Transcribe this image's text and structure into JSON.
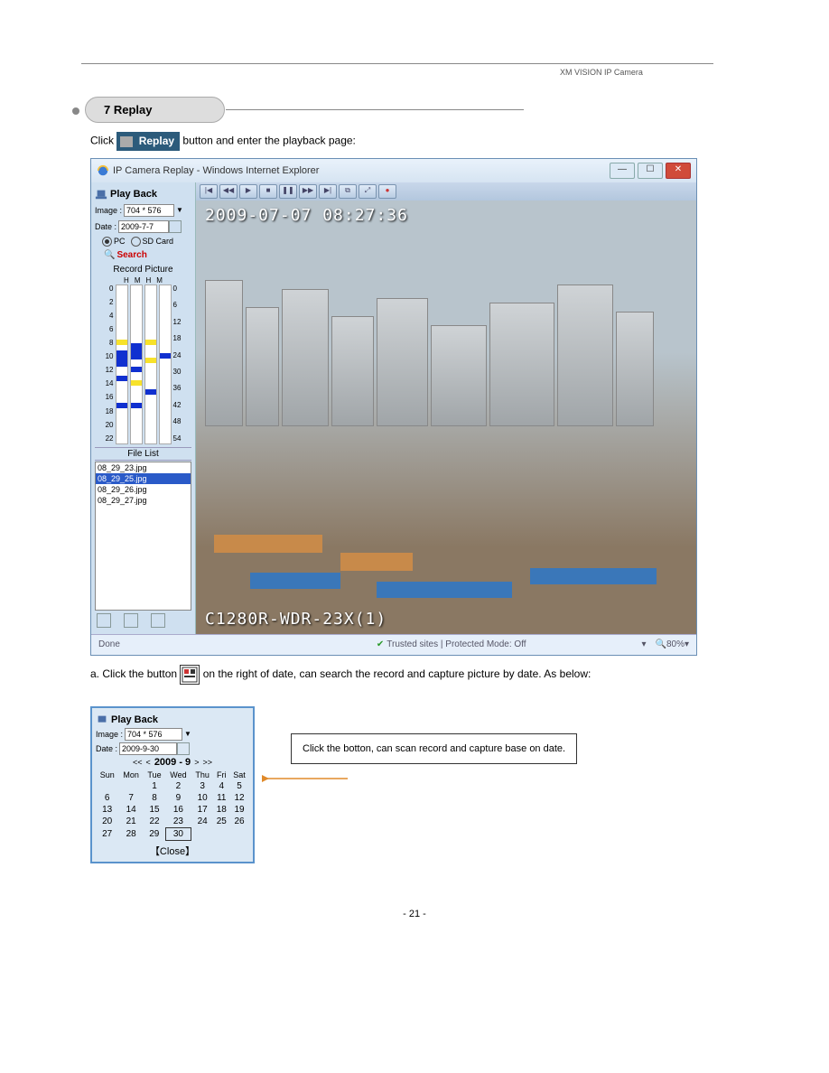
{
  "header": {
    "brand": "XM VISION  IP Camera"
  },
  "section": {
    "title": "7  Replay",
    "intro": "Click ",
    "intro_after": " button and enter the playback page:",
    "replay_label": "Replay"
  },
  "ie_window": {
    "title": "IP Camera Replay - Windows Internet Explorer",
    "status_left": "Done",
    "status_security": "Trusted sites | Protected Mode: Off",
    "status_zoom": "80%"
  },
  "playback": {
    "title": "Play Back",
    "image_label": "Image :",
    "image_value": "704 * 576",
    "date_label": "Date :",
    "date_value": "2009-7-7",
    "pc_label": "PC",
    "sd_label": "SD Card",
    "search_label": "Search",
    "record_picture_label": "Record Picture",
    "left_hours": [
      "0",
      "2",
      "4",
      "6",
      "8",
      "10",
      "12",
      "14",
      "16",
      "18",
      "20",
      "22"
    ],
    "right_hours": [
      "0",
      "6",
      "12",
      "18",
      "24",
      "30",
      "36",
      "42",
      "48",
      "54"
    ],
    "hm_labels": [
      "H",
      "M",
      "H",
      "M"
    ],
    "file_list_label": "File List",
    "files": [
      "08_29_23.jpg",
      "08_29_25.jpg",
      "08_29_26.jpg",
      "08_29_27.jpg"
    ]
  },
  "video": {
    "timestamp": "2009-07-07 08:27:36",
    "camera_name": "C1280R-WDR-23X(1)"
  },
  "step": {
    "a_prefix": "a. Click the button ",
    "a_suffix": " on the right of date, can search the record and capture picture by date. As below:",
    "cal_title": "Play Back",
    "cal_image_value": "704 * 576",
    "cal_date_value": "2009-9-30",
    "cal_month": "2009 - 9",
    "cal_dow": [
      "Sun",
      "Mon",
      "Tue",
      "Wed",
      "Thu",
      "Fri",
      "Sat"
    ],
    "cal_rows": [
      [
        "",
        "",
        "1",
        "2",
        "3",
        "4",
        "5"
      ],
      [
        "6",
        "7",
        "8",
        "9",
        "10",
        "11",
        "12"
      ],
      [
        "13",
        "14",
        "15",
        "16",
        "17",
        "18",
        "19"
      ],
      [
        "20",
        "21",
        "22",
        "23",
        "24",
        "25",
        "26"
      ],
      [
        "27",
        "28",
        "29",
        "30",
        "",
        "",
        ""
      ]
    ],
    "cal_close": "【Close】",
    "callout": "Click the botton, can scan record and capture base on date."
  },
  "footer": {
    "page_no": "- 21 -"
  }
}
